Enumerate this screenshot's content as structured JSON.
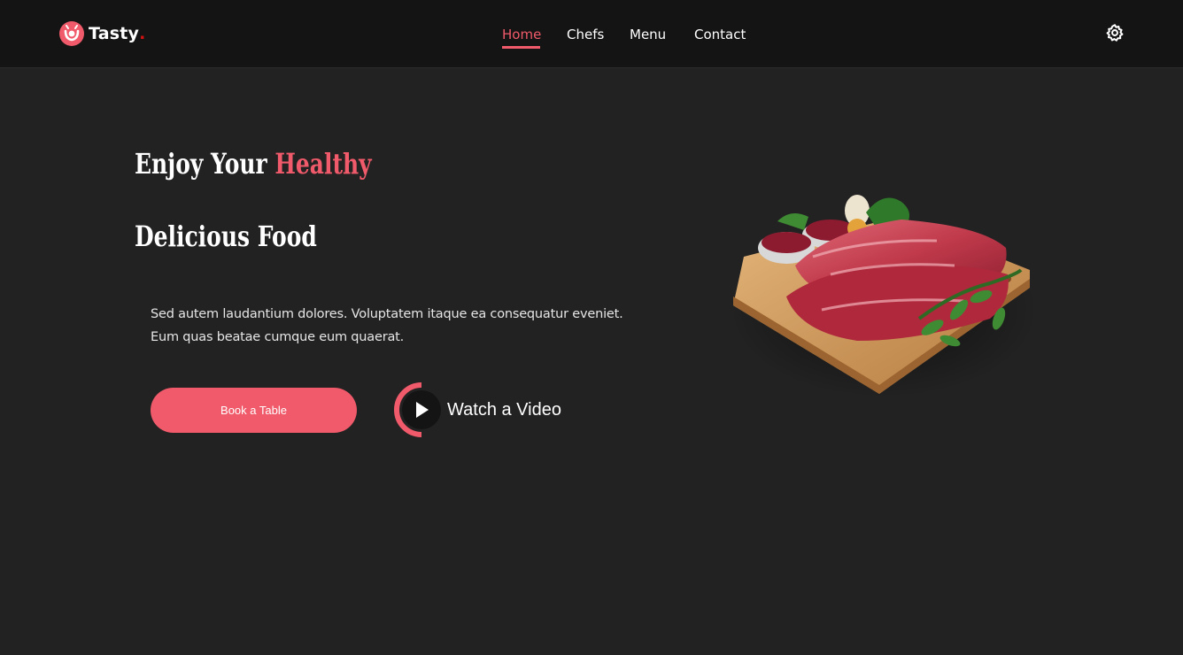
{
  "brand": {
    "name": "Tasty",
    "dot": ".",
    "accent_color": "#f05a6a"
  },
  "nav": {
    "items": [
      {
        "label": "Home",
        "active": true
      },
      {
        "label": "Chefs",
        "active": false
      },
      {
        "label": "Menu",
        "active": false
      },
      {
        "label": "Contact",
        "active": false
      }
    ]
  },
  "header": {
    "settings_icon": "gear-icon"
  },
  "hero": {
    "title": {
      "line1_part1": "Enjoy Your",
      "line1_accent": "Healthy",
      "line2": "Delicious Food"
    },
    "description_line1": "Sed autem laudantium dolores. Voluptatem itaque ea consequatur eveniet.",
    "description_line2": "Eum quas beatae cumque eum quaerat.",
    "book_button": "Book a Table",
    "video_button": "Watch a Video",
    "image_icon": "meat-on-cutting-board-image"
  },
  "colors": {
    "background": "#222222",
    "header": "#141414",
    "accent": "#f05a6a",
    "text": "#ffffff"
  }
}
